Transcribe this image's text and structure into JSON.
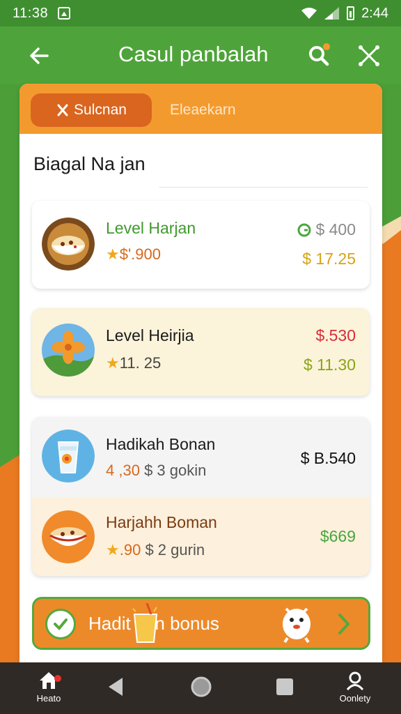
{
  "status_bar": {
    "time_left": "11:38",
    "time_right": "2:44"
  },
  "app_bar": {
    "title": "Casul panbalah"
  },
  "tabs": [
    {
      "label": "Sulcnan",
      "icon": "fork-knife-icon",
      "active": true
    },
    {
      "label": "Eleaekarn",
      "active": false
    }
  ],
  "section": {
    "title": "Biagal Na jan"
  },
  "items": [
    {
      "name": "Level Harjan",
      "subtitle_star": "★",
      "subtitle": "$'.900",
      "price_top": "$ 400",
      "price_bottom": "$ 17.25",
      "thumb": "soup-bowl",
      "colors": {
        "name": "#3f9a2c",
        "subtitle": "#d6681b",
        "price_top": "#8a8a8a",
        "price_bottom": "#d8a312"
      }
    },
    {
      "name": "Level Heirjia",
      "subtitle_star": "★",
      "subtitle": "11. 25",
      "price_top": "$.530",
      "price_bottom": "$ 11.30",
      "thumb": "flower",
      "colors": {
        "name": "#1a1a1a",
        "subtitle": "#444444",
        "price_top": "#d92c3a",
        "price_bottom": "#8aa514"
      }
    },
    {
      "name": "Hadikah Bonan",
      "subtitle_prefix": "4 ,30",
      "subtitle": "$ 3 gokin",
      "price": "$ B.540",
      "thumb": "drink-cup",
      "colors": {
        "name": "#1a1a1a",
        "subtitle_prefix": "#d6681b",
        "subtitle": "#555555",
        "price": "#111111"
      }
    },
    {
      "name": "Harjahh Boman",
      "subtitle_star": "★",
      "subtitle_prefix": ".90",
      "subtitle": "$ 2 gurin",
      "price": "$669",
      "thumb": "soup-bowl",
      "colors": {
        "name": "#7a3b12",
        "subtitle_prefix": "#d6681b",
        "subtitle": "#555555",
        "price": "#4aa640"
      }
    }
  ],
  "bonus": {
    "label": "Hadit   atin bonus"
  },
  "bottom_nav": {
    "home_label": "Heato",
    "profile_label": "Oonlety"
  }
}
